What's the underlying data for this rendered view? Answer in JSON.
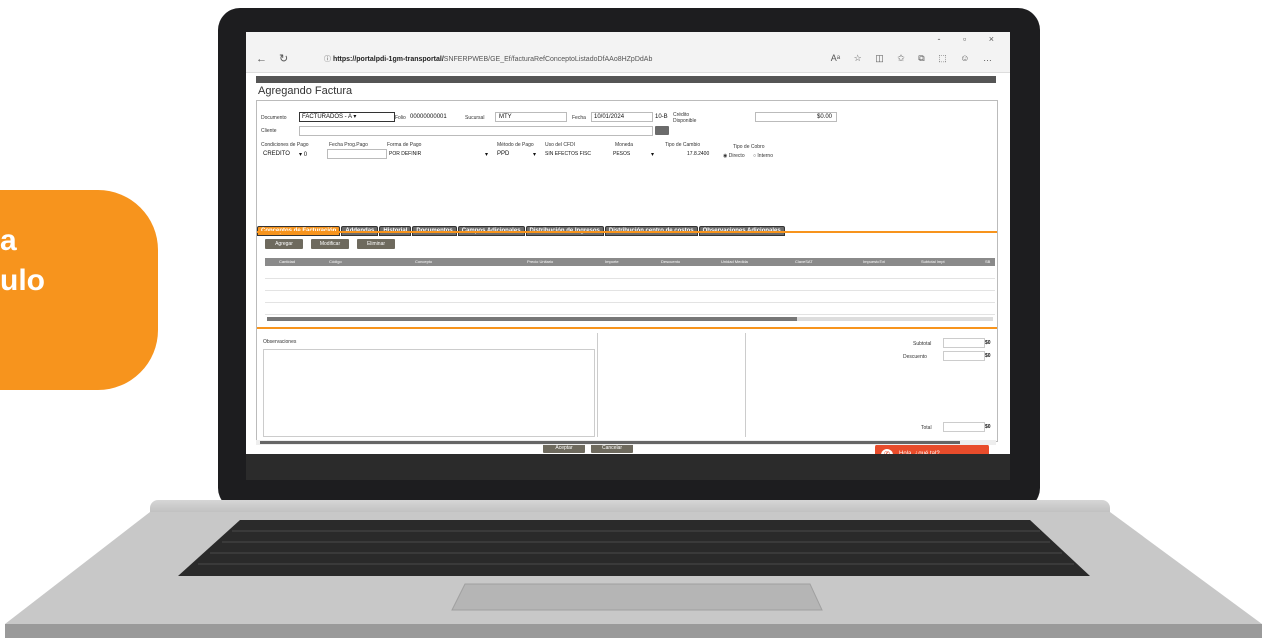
{
  "badge": {
    "line1": "a",
    "line2": "ulo",
    "color": "#f7941d"
  },
  "browser": {
    "nav_icons": [
      "back-icon",
      "reload-icon"
    ],
    "url_bold": "https://portalpdi-1gm-transportal/",
    "url_rest": "SNFERPWEB/GE_Ef/facturaRefConceptoListadoDfAAo8HZpDdAb",
    "window_controls": "- ▫ ×"
  },
  "page": {
    "title": "Agregando Factura",
    "labels": {
      "documento": "Documento",
      "folio": "Folio",
      "sucursal": "Sucursal",
      "fecha": "Fecha",
      "cliente": "Cliente",
      "credito_disp": "Crédito Disponible",
      "condiciones": "Condiciones de Pago",
      "fecha_prog": "Fecha Prog.Pago",
      "forma_pago": "Forma de Pago",
      "metodo_pago": "Método de Pago",
      "uso_cfdi": "Uso del CFDI",
      "moneda": "Moneda",
      "tipo_cambio": "Tipo de Cambio",
      "tipo_cobro": "Tipo de Cobro",
      "directo": "Directo",
      "interno": "Interno"
    },
    "values": {
      "documento": "FACTURADOS - A",
      "folio": "00000000001",
      "sucursal": "MTY",
      "fecha": "10/01/2024",
      "credito_code": "10-B",
      "credito_disp": "$0.00",
      "condiciones": "CREDITO",
      "cond_days": "0",
      "forma_pago": "POR DEFINIR",
      "metodo_pago": "PPD",
      "uso_cfdi": "SIN EFECTOS FISC",
      "moneda": "PESOS",
      "tipo_cambio": "17.8.2400"
    },
    "tabs": [
      {
        "label": "Conceptos de Facturación",
        "active": true
      },
      {
        "label": "Addendas",
        "active": false
      },
      {
        "label": "Historial",
        "active": false
      },
      {
        "label": "Documentos",
        "active": false
      },
      {
        "label": "Campos Adicionales",
        "active": false
      },
      {
        "label": "Distribución de Ingresos",
        "active": false
      },
      {
        "label": "Distribución centro de costos",
        "active": false
      },
      {
        "label": "Observaciones Adicionales",
        "active": false
      }
    ],
    "grid_buttons": {
      "agregar": "Agregar",
      "modificar": "Modificar",
      "eliminar": "Eliminar"
    },
    "grid_columns": [
      "Cantidad",
      "Código",
      "Concepto",
      "Precio Unitario",
      "Importe",
      "Descuento",
      "Unidad Medida",
      "ClaveSAT",
      "ImpuestoTot",
      "Subtotal Impt",
      "SB"
    ],
    "observaciones": "Observaciones",
    "totals": {
      "subtotal": "Subtotal",
      "descuento": "Descuento",
      "total": "Total",
      "subtotal_val": "$0",
      "descuento_val": "$0",
      "total_val": "$0"
    },
    "bottom_buttons": {
      "aceptar": "Aceptar",
      "cancelar": "Cancelar"
    },
    "chat": {
      "text": "Hola, ¿qué tal?"
    }
  }
}
